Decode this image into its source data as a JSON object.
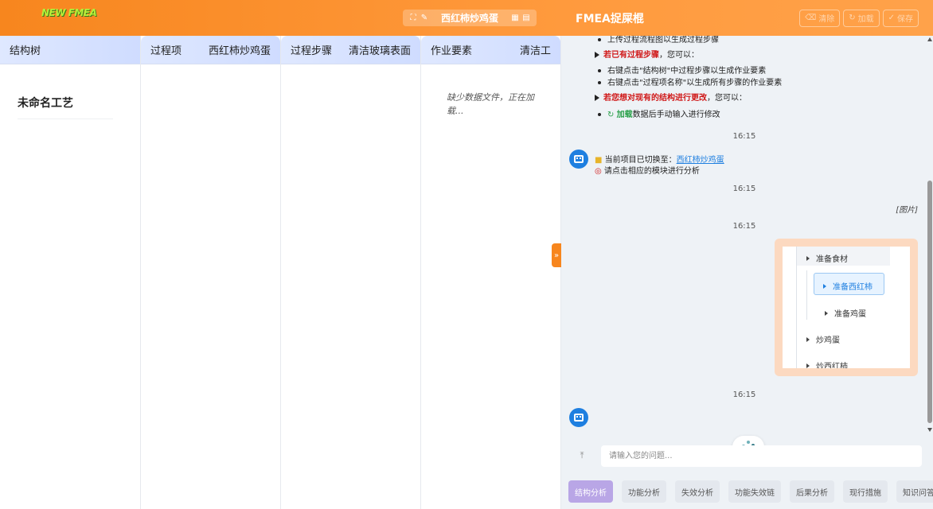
{
  "app": {
    "logo_text": "NEW FMEA",
    "project_name": "西红柿炒鸡蛋"
  },
  "columns": {
    "structure_tree": {
      "title": "结构树",
      "root": "未命名工艺"
    },
    "process_item": {
      "title": "过程项",
      "value": "西红柿炒鸡蛋"
    },
    "process_step": {
      "title": "过程步骤",
      "value": "清洁玻璃表面"
    },
    "work_element": {
      "title": "作业要素",
      "value": "清洁工",
      "loading": "缺少数据文件，正在加载..."
    }
  },
  "chat": {
    "title": "FMEA捉屎棍",
    "buttons": {
      "clear": "清除",
      "load": "加载",
      "save": "保存"
    },
    "messages": {
      "upload_flow": "上传过程流程图以生成过程步骤",
      "if_steps_prefix": "若已有过程步骤",
      "if_steps_suffix": "，您可以：",
      "bullet1": "右键点击\"结构树\"中过程步骤以生成作业要素",
      "bullet2": "右键点击\"过程项名称\"以生成所有步骤的作业要素",
      "modify_prefix": "若您想对现有的结构进行更改",
      "modify_suffix": "，您可以：",
      "load_word": "加载",
      "load_suffix": "数据后手动输入进行修改",
      "time1": "16:15",
      "switched_prefix": "当前项目已切换至：",
      "switched_link": "西红柿炒鸡蛋",
      "click_module": "请点击相应的模块进行分析",
      "time2": "16:15",
      "image_tag": "[图片]",
      "time3": "16:15",
      "time4": "16:15"
    },
    "image_tree": {
      "n1": "准备食材",
      "n2": "准备西红柿",
      "n3": "准备鸡蛋",
      "n4": "炒鸡蛋",
      "n5": "炒西红柿"
    },
    "input_placeholder": "请输入您的问题...",
    "tabs": [
      "结构分析",
      "功能分析",
      "失效分析",
      "功能失效链",
      "后果分析",
      "现行措施",
      "知识问答"
    ],
    "active_tab": "结构分析"
  },
  "colors": {
    "accent": "#f7861e",
    "header_blue": "#dfe8ff",
    "link": "#1e7fe0",
    "warning_red": "#d01818",
    "active_tab": "#b9a6e6"
  }
}
